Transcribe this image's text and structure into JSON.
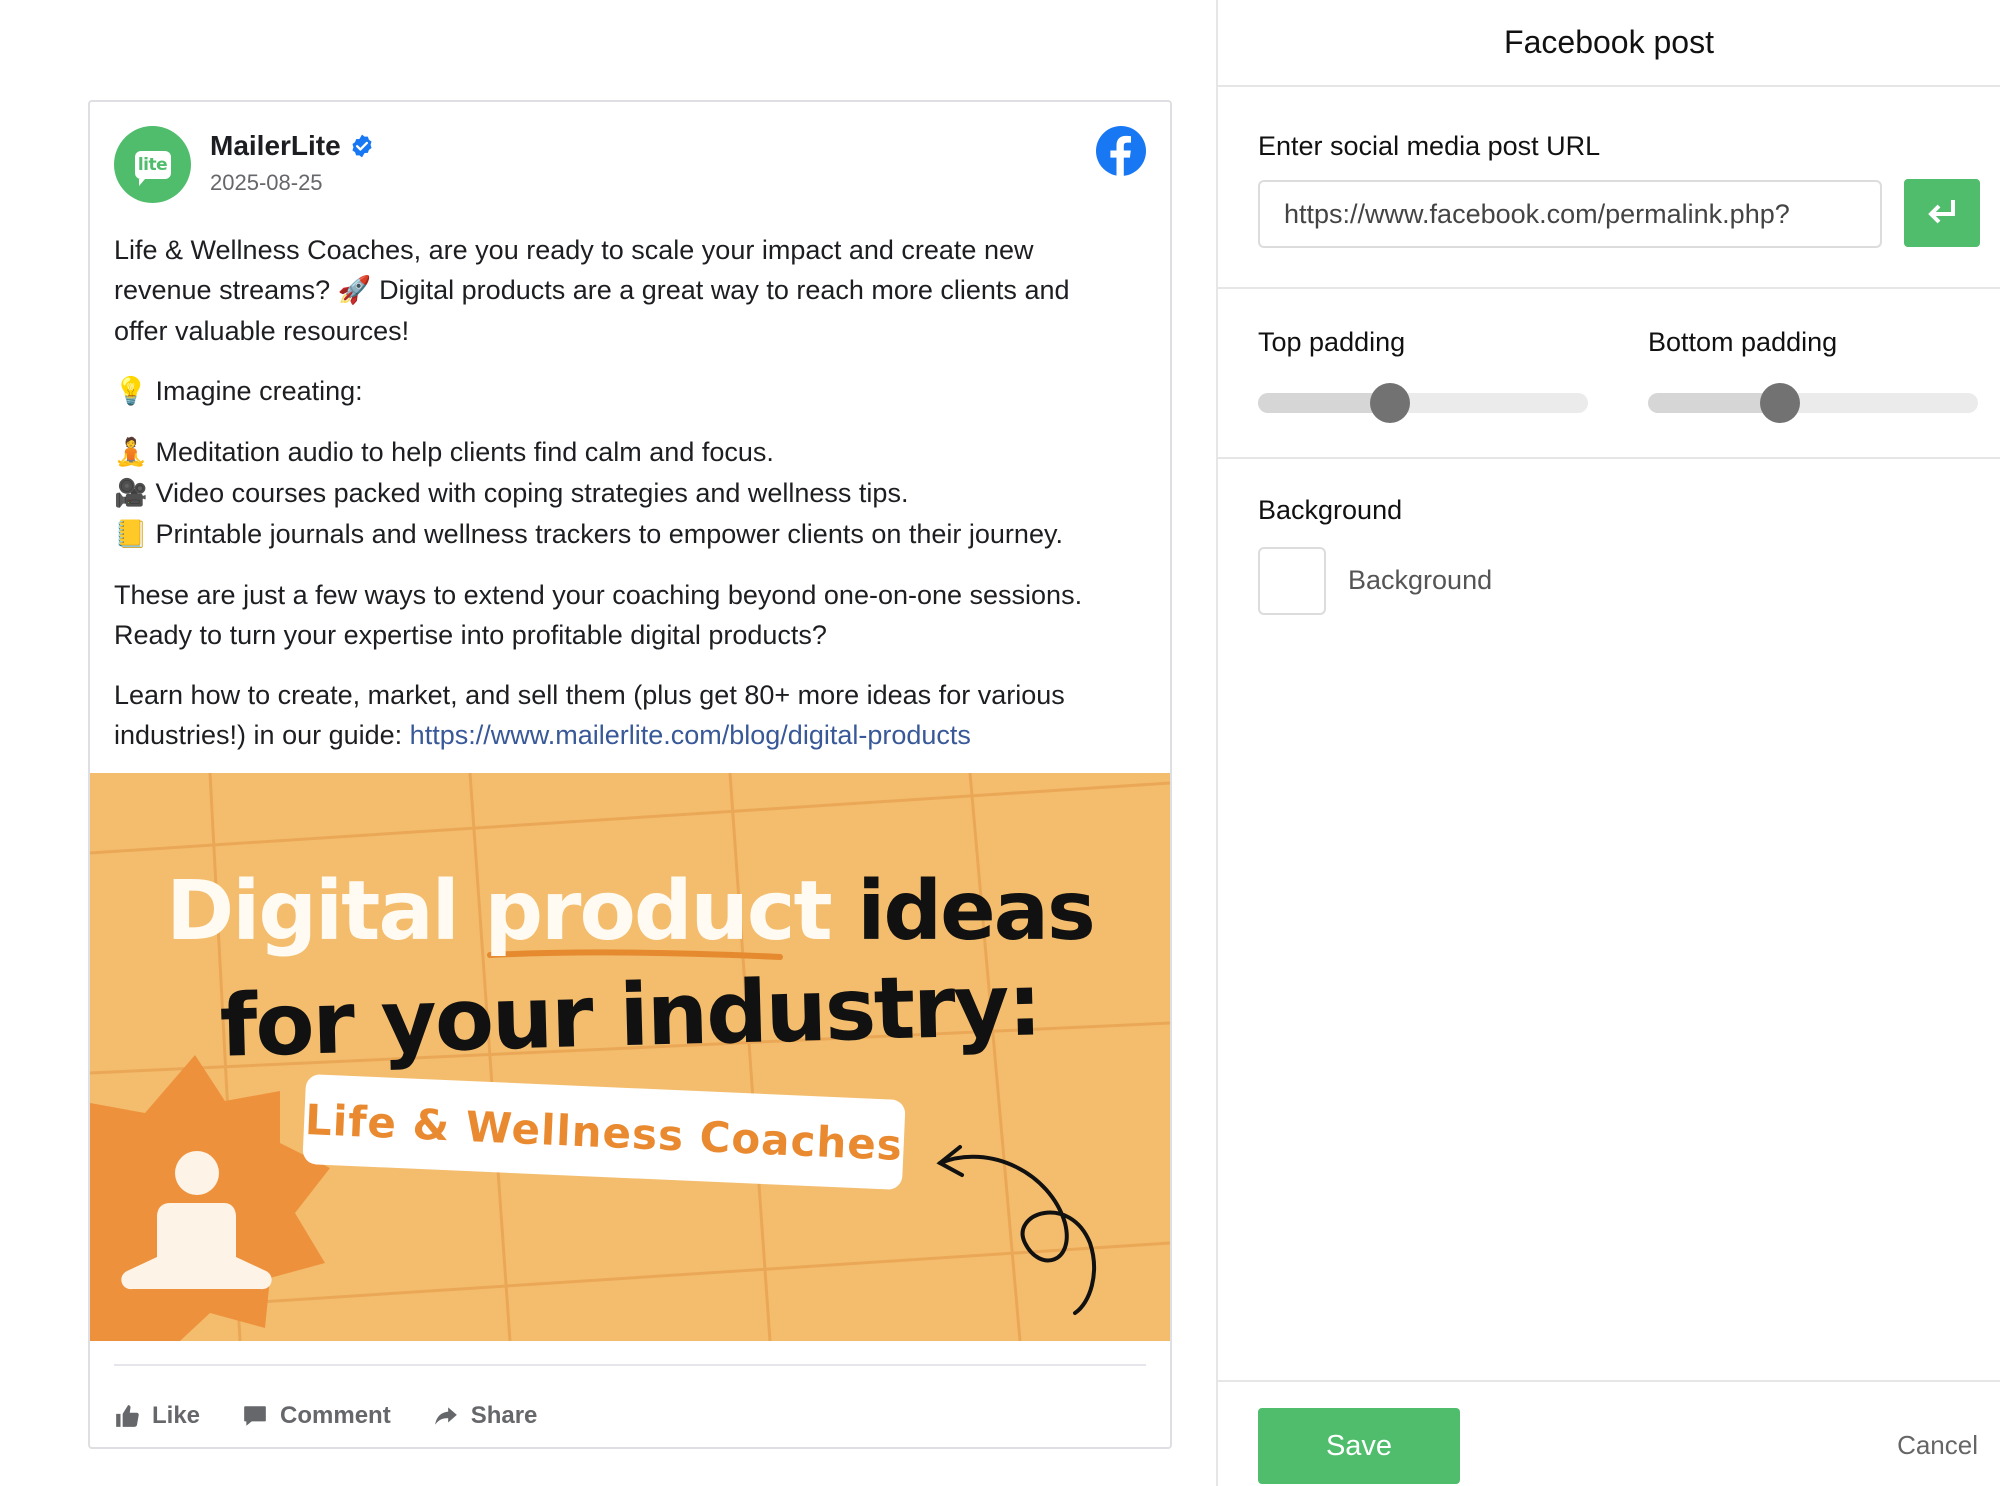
{
  "post": {
    "author": "MailerLite",
    "avatar_text": "lite",
    "date": "2025-08-25",
    "paragraph1": {
      "line1": "Life & Wellness Coaches, are you ready to scale your impact and create new",
      "line2_a": "revenue streams?",
      "line2_emoji": "🚀",
      "line2_b": "Digital products are a great way to reach more clients and",
      "line3": "offer valuable resources!"
    },
    "imagine": {
      "emoji": "💡",
      "text": "Imagine creating:"
    },
    "ideas": [
      {
        "emoji": "🧘",
        "text": "Meditation audio to help clients find calm and focus."
      },
      {
        "emoji": "🎥",
        "text": "Video courses packed with coping strategies and wellness tips."
      },
      {
        "emoji": "📒",
        "text": "Printable journals and wellness trackers to empower clients on their journey."
      }
    ],
    "paragraph3": {
      "line1": "These are just a few ways to extend your coaching beyond one-on-one sessions.",
      "line2": "Ready to turn your expertise into profitable digital products?"
    },
    "paragraph4": {
      "line1": "Learn how to create, market, and sell them (plus get 80+ more ideas for various",
      "line2": "industries!) in our guide:",
      "link": "https://www.mailerlite.com/blog/digital-products"
    },
    "image": {
      "title_word1": "Digital",
      "title_word2": "product",
      "title_word3": "ideas",
      "title_line2": "for your industry:",
      "pill": "Life & Wellness Coaches",
      "background_color": "#f3bd6d"
    },
    "actions": {
      "like": "Like",
      "comment": "Comment",
      "share": "Share"
    }
  },
  "panel": {
    "title": "Facebook post",
    "url_label": "Enter social media post URL",
    "url_value": "https://www.facebook.com/permalink.php?",
    "top_padding_label": "Top padding",
    "top_padding_level": 0.4,
    "bottom_padding_label": "Bottom padding",
    "bottom_padding_level": 0.4,
    "background_label": "Background",
    "background_swatch_label": "Background",
    "background_color": "#ffffff",
    "save": "Save",
    "cancel": "Cancel"
  },
  "colors": {
    "accent": "#4fbd6c",
    "link": "#385898",
    "facebook": "#1877f2"
  },
  "icons": [
    "verified-badge-icon",
    "facebook-icon",
    "like-icon",
    "comment-icon",
    "share-icon",
    "enter-icon",
    "meditation-icon",
    "curly-arrow-icon"
  ]
}
